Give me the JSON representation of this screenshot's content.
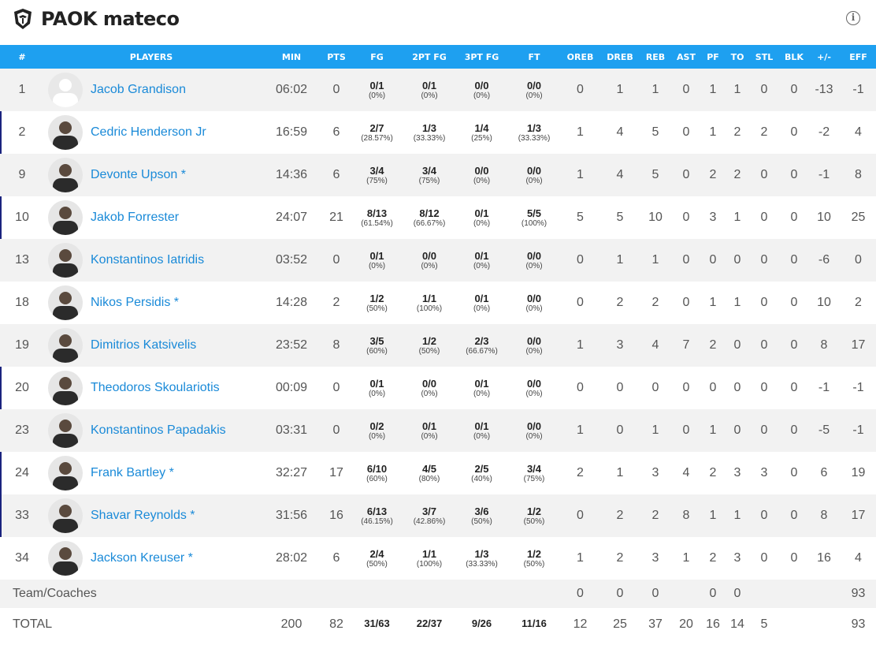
{
  "team": {
    "name": "PAOK mateco",
    "logo_icon": "paok-shield-icon",
    "info_icon": "info-icon"
  },
  "columns": [
    "#",
    "PLAYERS",
    "MIN",
    "PTS",
    "FG",
    "2PT FG",
    "3PT FG",
    "FT",
    "OREB",
    "DREB",
    "REB",
    "AST",
    "PF",
    "TO",
    "STL",
    "BLK",
    "+/-",
    "EFF"
  ],
  "players": [
    {
      "num": "1",
      "name": "Jacob Grandison",
      "starter": false,
      "blank": true,
      "min": "06:02",
      "pts": "0",
      "fg": "0/1",
      "fgp": "(0%)",
      "p2": "0/1",
      "p2p": "(0%)",
      "p3": "0/0",
      "p3p": "(0%)",
      "ft": "0/0",
      "ftp": "(0%)",
      "oreb": "0",
      "dreb": "1",
      "reb": "1",
      "ast": "0",
      "pf": "1",
      "to": "1",
      "stl": "0",
      "blk": "0",
      "pm": "-13",
      "eff": "-1"
    },
    {
      "num": "2",
      "name": "Cedric Henderson Jr",
      "starter": true,
      "blank": false,
      "min": "16:59",
      "pts": "6",
      "fg": "2/7",
      "fgp": "(28.57%)",
      "p2": "1/3",
      "p2p": "(33.33%)",
      "p3": "1/4",
      "p3p": "(25%)",
      "ft": "1/3",
      "ftp": "(33.33%)",
      "oreb": "1",
      "dreb": "4",
      "reb": "5",
      "ast": "0",
      "pf": "1",
      "to": "2",
      "stl": "2",
      "blk": "0",
      "pm": "-2",
      "eff": "4"
    },
    {
      "num": "9",
      "name": "Devonte Upson *",
      "starter": false,
      "blank": false,
      "min": "14:36",
      "pts": "6",
      "fg": "3/4",
      "fgp": "(75%)",
      "p2": "3/4",
      "p2p": "(75%)",
      "p3": "0/0",
      "p3p": "(0%)",
      "ft": "0/0",
      "ftp": "(0%)",
      "oreb": "1",
      "dreb": "4",
      "reb": "5",
      "ast": "0",
      "pf": "2",
      "to": "2",
      "stl": "0",
      "blk": "0",
      "pm": "-1",
      "eff": "8"
    },
    {
      "num": "10",
      "name": "Jakob Forrester",
      "starter": true,
      "blank": false,
      "min": "24:07",
      "pts": "21",
      "fg": "8/13",
      "fgp": "(61.54%)",
      "p2": "8/12",
      "p2p": "(66.67%)",
      "p3": "0/1",
      "p3p": "(0%)",
      "ft": "5/5",
      "ftp": "(100%)",
      "oreb": "5",
      "dreb": "5",
      "reb": "10",
      "ast": "0",
      "pf": "3",
      "to": "1",
      "stl": "0",
      "blk": "0",
      "pm": "10",
      "eff": "25"
    },
    {
      "num": "13",
      "name": "Konstantinos Iatridis",
      "starter": false,
      "blank": false,
      "min": "03:52",
      "pts": "0",
      "fg": "0/1",
      "fgp": "(0%)",
      "p2": "0/0",
      "p2p": "(0%)",
      "p3": "0/1",
      "p3p": "(0%)",
      "ft": "0/0",
      "ftp": "(0%)",
      "oreb": "0",
      "dreb": "1",
      "reb": "1",
      "ast": "0",
      "pf": "0",
      "to": "0",
      "stl": "0",
      "blk": "0",
      "pm": "-6",
      "eff": "0"
    },
    {
      "num": "18",
      "name": "Nikos Persidis *",
      "starter": false,
      "blank": false,
      "min": "14:28",
      "pts": "2",
      "fg": "1/2",
      "fgp": "(50%)",
      "p2": "1/1",
      "p2p": "(100%)",
      "p3": "0/1",
      "p3p": "(0%)",
      "ft": "0/0",
      "ftp": "(0%)",
      "oreb": "0",
      "dreb": "2",
      "reb": "2",
      "ast": "0",
      "pf": "1",
      "to": "1",
      "stl": "0",
      "blk": "0",
      "pm": "10",
      "eff": "2"
    },
    {
      "num": "19",
      "name": "Dimitrios Katsivelis",
      "starter": false,
      "blank": false,
      "min": "23:52",
      "pts": "8",
      "fg": "3/5",
      "fgp": "(60%)",
      "p2": "1/2",
      "p2p": "(50%)",
      "p3": "2/3",
      "p3p": "(66.67%)",
      "ft": "0/0",
      "ftp": "(0%)",
      "oreb": "1",
      "dreb": "3",
      "reb": "4",
      "ast": "7",
      "pf": "2",
      "to": "0",
      "stl": "0",
      "blk": "0",
      "pm": "8",
      "eff": "17"
    },
    {
      "num": "20",
      "name": "Theodoros Skoulariotis",
      "starter": true,
      "blank": false,
      "min": "00:09",
      "pts": "0",
      "fg": "0/1",
      "fgp": "(0%)",
      "p2": "0/0",
      "p2p": "(0%)",
      "p3": "0/1",
      "p3p": "(0%)",
      "ft": "0/0",
      "ftp": "(0%)",
      "oreb": "0",
      "dreb": "0",
      "reb": "0",
      "ast": "0",
      "pf": "0",
      "to": "0",
      "stl": "0",
      "blk": "0",
      "pm": "-1",
      "eff": "-1"
    },
    {
      "num": "23",
      "name": "Konstantinos Papadakis",
      "starter": false,
      "blank": false,
      "min": "03:31",
      "pts": "0",
      "fg": "0/2",
      "fgp": "(0%)",
      "p2": "0/1",
      "p2p": "(0%)",
      "p3": "0/1",
      "p3p": "(0%)",
      "ft": "0/0",
      "ftp": "(0%)",
      "oreb": "1",
      "dreb": "0",
      "reb": "1",
      "ast": "0",
      "pf": "1",
      "to": "0",
      "stl": "0",
      "blk": "0",
      "pm": "-5",
      "eff": "-1"
    },
    {
      "num": "24",
      "name": "Frank Bartley *",
      "starter": true,
      "blank": false,
      "min": "32:27",
      "pts": "17",
      "fg": "6/10",
      "fgp": "(60%)",
      "p2": "4/5",
      "p2p": "(80%)",
      "p3": "2/5",
      "p3p": "(40%)",
      "ft": "3/4",
      "ftp": "(75%)",
      "oreb": "2",
      "dreb": "1",
      "reb": "3",
      "ast": "4",
      "pf": "2",
      "to": "3",
      "stl": "3",
      "blk": "0",
      "pm": "6",
      "eff": "19"
    },
    {
      "num": "33",
      "name": "Shavar Reynolds *",
      "starter": true,
      "blank": false,
      "min": "31:56",
      "pts": "16",
      "fg": "6/13",
      "fgp": "(46.15%)",
      "p2": "3/7",
      "p2p": "(42.86%)",
      "p3": "3/6",
      "p3p": "(50%)",
      "ft": "1/2",
      "ftp": "(50%)",
      "oreb": "0",
      "dreb": "2",
      "reb": "2",
      "ast": "8",
      "pf": "1",
      "to": "1",
      "stl": "0",
      "blk": "0",
      "pm": "8",
      "eff": "17"
    },
    {
      "num": "34",
      "name": "Jackson Kreuser *",
      "starter": false,
      "blank": false,
      "min": "28:02",
      "pts": "6",
      "fg": "2/4",
      "fgp": "(50%)",
      "p2": "1/1",
      "p2p": "(100%)",
      "p3": "1/3",
      "p3p": "(33.33%)",
      "ft": "1/2",
      "ftp": "(50%)",
      "oreb": "1",
      "dreb": "2",
      "reb": "3",
      "ast": "1",
      "pf": "2",
      "to": "3",
      "stl": "0",
      "blk": "0",
      "pm": "16",
      "eff": "4"
    }
  ],
  "team_row": {
    "label": "Team/Coaches",
    "oreb": "0",
    "dreb": "0",
    "reb": "0",
    "pf": "0",
    "to": "0",
    "eff": "93"
  },
  "total_row": {
    "label": "TOTAL",
    "min": "200",
    "pts": "82",
    "fg": "31/63",
    "p2": "22/37",
    "p3": "9/26",
    "ft": "11/16",
    "oreb": "12",
    "dreb": "25",
    "reb": "37",
    "ast": "20",
    "pf": "16",
    "to": "14",
    "stl": "5",
    "eff": "93"
  }
}
